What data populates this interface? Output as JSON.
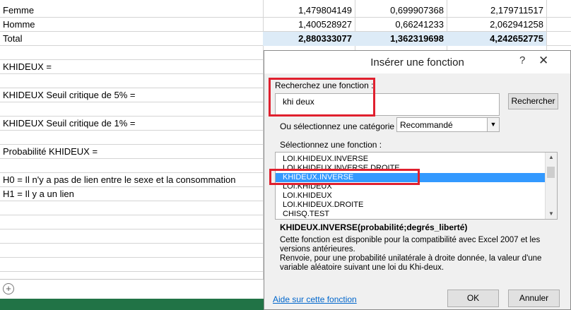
{
  "sheet": {
    "rows": [
      {
        "label": "Femme",
        "v1": "1,479804149",
        "v2": "0,699907368",
        "v3": "2,179711517"
      },
      {
        "label": "Homme",
        "v1": "1,400528927",
        "v2": "0,66241233",
        "v3": "2,062941258"
      },
      {
        "label": "Total",
        "v1": "2,880333077",
        "v2": "1,362319698",
        "v3": "4,242652775"
      }
    ],
    "khideux": "KHIDEUX =",
    "seuil5": "KHIDEUX Seuil critique de 5% =",
    "seuil1": "KHIDEUX Seuil critique de 1% =",
    "proba": "Probabilité KHIDEUX =",
    "h0": "H0 = Il n'y a pas de lien entre le sexe et la consommation",
    "h1": "H1 = Il y a un lien",
    "add_sheet_glyph": "+"
  },
  "dialog": {
    "title": "Insérer une fonction",
    "help_glyph": "?",
    "close_glyph": "✕",
    "search_label": "Recherchez une fonction :",
    "search_value": "khi deux",
    "search_button": "Rechercher",
    "category_label": "Ou sélectionnez une catégorie :",
    "category_value": "Recommandé",
    "select_function_label": "Sélectionnez une fonction :",
    "functions": [
      "LOI.KHIDEUX.INVERSE",
      "LOI.KHIDEUX.INVERSE.DROITE",
      "KHIDEUX.INVERSE",
      "LOI.KHIDEUX",
      "LOI.KHIDEUX",
      "LOI.KHIDEUX.DROITE",
      "CHISQ.TEST"
    ],
    "selected_function": "KHIDEUX.INVERSE",
    "signature": "KHIDEUX.INVERSE(probabilité;degrés_liberté)",
    "description": "Cette fonction est disponible pour la compatibilité avec Excel 2007 et les versions antérieures.\nRenvoie, pour une probabilité unilatérale à droite donnée, la valeur d'une variable aléatoire suivant une loi du Khi-deux.",
    "help_link": "Aide sur cette fonction",
    "ok_button": "OK",
    "cancel_button": "Annuler"
  }
}
